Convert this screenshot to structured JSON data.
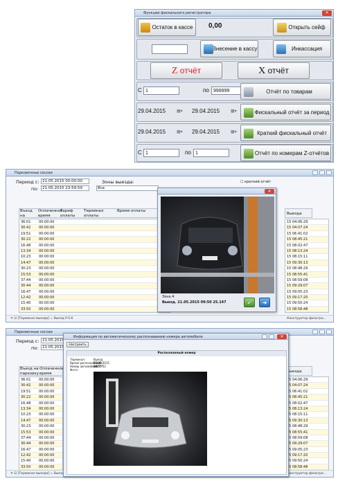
{
  "fiscal": {
    "title": "Функции фискального регистратора",
    "balance_button": "Остаток в кассе",
    "balance_value": "0,00",
    "open_safe": "Открыть сейф",
    "cash_in_input": "",
    "cash_in": "Внесение в кассу",
    "collection": "Инкассация",
    "z_letter": "Z",
    "x_letter": "X",
    "report_word": "отчёт",
    "from_label": "С",
    "from_value": "1",
    "to_label": "по",
    "to_value": "999999",
    "by_goods": "Отчёт по товарам",
    "date_from": "29.04.2015",
    "date_to": "29.04.2015",
    "fiscal_period": "Фискальный отчёт за период",
    "date_from2": "29.04.2015",
    "date_to2": "29.04.2015",
    "short_fiscal": "Краткий фискальный отчёт",
    "zfrom_label": "С",
    "zfrom_value": "1",
    "zto_label": "по",
    "zto_value": "1",
    "by_z": "Отчёт по номерам Z-отчётов"
  },
  "parking": {
    "title": "Парковочные сессии",
    "period_label": "Период с:",
    "period_from": "21.05.2015 00:00:00",
    "to_label": "по:",
    "period_to": "21.05.2015 23:59:59",
    "zones_label": "Зоны выезда:",
    "zones_value": "Все",
    "short_report": "краткий отчёт",
    "columns": [
      "Въезд на парковку",
      "Оплаченное время",
      "Тариф оплаты",
      "Терминал оплаты",
      "Время оплаты"
    ],
    "right_header": "Выезда",
    "rows": [
      {
        "time": "36:01",
        "paid": "00:00:00",
        "exit": "15 04:06:29"
      },
      {
        "time": "30:42",
        "paid": "00:00:00",
        "exit": "15 04:07:24"
      },
      {
        "time": "19:51",
        "paid": "00:00:00",
        "exit": "15 06:41:02"
      },
      {
        "time": "30:22",
        "paid": "00:00:00",
        "exit": "15 08:45:21"
      },
      {
        "time": "16:48",
        "paid": "00:00:00",
        "exit": "15 08:02:47"
      },
      {
        "time": "13:34",
        "paid": "00:00:00",
        "exit": "15 08:13:24"
      },
      {
        "time": "10:23",
        "paid": "00:00:00",
        "exit": "15 08:15:11"
      },
      {
        "time": "14:47",
        "paid": "00:00:00",
        "exit": "15 09:30:13"
      },
      {
        "time": "30:23",
        "paid": "00:00:00",
        "exit": "15 08:48:29"
      },
      {
        "time": "15:53",
        "paid": "00:00:00",
        "exit": "15 08:55:41"
      },
      {
        "time": "37:44",
        "paid": "00:00:00",
        "exit": "15 08:59:08"
      },
      {
        "time": "30:44",
        "paid": "00:00:00",
        "exit": "15 09:29:07"
      },
      {
        "time": "16:47",
        "paid": "00:00:00",
        "exit": "15 09:05:23"
      },
      {
        "time": "12:42",
        "paid": "00:00:00",
        "exit": "15 09:17:20"
      },
      {
        "time": "15:40",
        "paid": "00:00:00",
        "exit": "15 09:50:24"
      },
      {
        "time": "33:50",
        "paid": "00:00:00",
        "exit": "15 08:58:48"
      }
    ],
    "status_filter": "[Терминал выезда] = Выезд Р.0.6",
    "status_right": "Конструктор фильтра..."
  },
  "camera_popup": {
    "title": "",
    "caption_zone": "Зона 4",
    "caption_text": "Выезд. 21.05.2015 09:50 25.147",
    "ok_label": "",
    "next_label": ""
  },
  "recognition": {
    "title": "Информация по автоматическому распознаванию номера автомобиля",
    "setup_button": "Настроить",
    "inner_title": "Распознанный номер",
    "terminal_label": "Терминал:",
    "terminal_value": "Выезд Р.0.6",
    "time_label": "Время распознавания:",
    "time_value": "21.05.2015 09:50:52",
    "plate_label": "Номер автомобиля:",
    "plate_value": "А47***",
    "photo_label": "Фото:"
  }
}
